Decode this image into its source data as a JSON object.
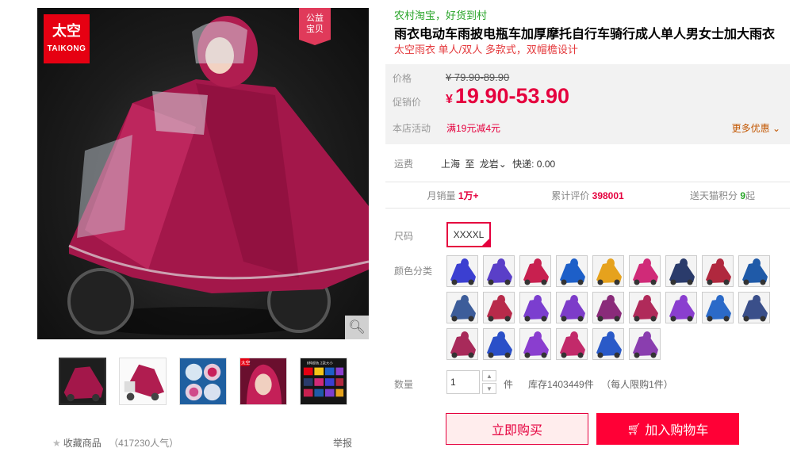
{
  "gallery": {
    "brand_logo_cn": "太空",
    "brand_logo_en": "TAIKONG",
    "charity_badge_line1": "公益",
    "charity_badge_line2": "宝贝",
    "thumb4_logo": "太空",
    "thumb5_caption": "8种颜色 2款大小",
    "thumbnails": [
      "raincoat-scooter-front",
      "raincoat-scooter-side",
      "raincoat-detail-collage",
      "raincoat-hood-closeup",
      "raincoat-color-grid"
    ]
  },
  "actions": {
    "favorite": "收藏商品",
    "favorite_count": "（417230人气）",
    "report": "举报"
  },
  "product": {
    "promo_tag": "农村淘宝，好货到村",
    "title": "雨衣电动车雨披电瓶车加厚摩托自行车骑行成人单人男女士加大雨衣",
    "subtitle": "太空雨衣 单人/双人 多款式，双帽檐设计"
  },
  "pricing": {
    "price_label": "价格",
    "original_price": "¥ 79.90-89.90",
    "promo_label": "促销价",
    "currency": "¥",
    "promo_price": "19.90-53.90",
    "activity_label": "本店活动",
    "activity": "满19元减4元",
    "more_offers": "更多优惠"
  },
  "shipping": {
    "label": "运费",
    "from": "上海",
    "to_word": "至",
    "destination": "龙岩",
    "method": "快递: 0.00"
  },
  "stats": {
    "monthly_sales_label": "月销量",
    "monthly_sales": "1万+",
    "reviews_label": "累计评价",
    "reviews": "398001",
    "points_label": "送天猫积分",
    "points": "9",
    "points_suffix": "起"
  },
  "sku": {
    "size_label": "尺码",
    "size_selected": "XXXXL",
    "color_label": "颜色分类",
    "swatch_colors": [
      "#3b3fd1",
      "#5a3fc8",
      "#c8204f",
      "#1d5fc8",
      "#e6a21d",
      "#d02a78",
      "#2a3b6b",
      "#b0283e",
      "#1f5aa8",
      "#3d5d9a",
      "#b82a4a",
      "#7b3ecf",
      "#7d3cc9",
      "#8a2b7a",
      "#b02a5a",
      "#8a3ecf",
      "#2b6ac8",
      "#3a4f8a",
      "#a82a5a",
      "#2a4fc8",
      "#8a3ecf",
      "#c22a6a",
      "#2a5ac8",
      "#8a3eaf"
    ]
  },
  "quantity": {
    "label": "数量",
    "value": "1",
    "unit": "件",
    "stock": "库存1403449件",
    "limit": "（每人限购1件）"
  },
  "buttons": {
    "buy_now": "立即购买",
    "add_cart": "加入购物车"
  }
}
